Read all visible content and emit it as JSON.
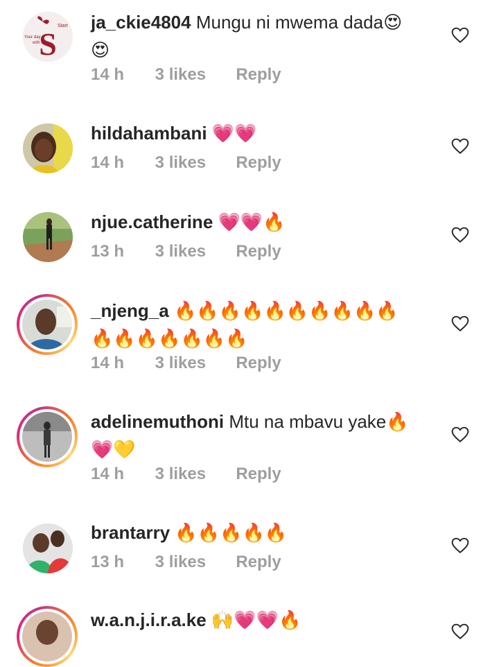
{
  "comments": [
    {
      "username": "ja_ckie4804",
      "text": "Mungu ni mwema dada😍",
      "text2": "😍",
      "time": "14 h",
      "likes": "3 likes",
      "reply": "Reply"
    },
    {
      "username": "hildahambani",
      "text": "💗💗",
      "time": "14 h",
      "likes": "3 likes",
      "reply": "Reply"
    },
    {
      "username": "njue.catherine",
      "text": "💗💗🔥",
      "time": "13 h",
      "likes": "3 likes",
      "reply": "Reply"
    },
    {
      "username": "_njeng_a",
      "text": "🔥🔥🔥🔥🔥🔥🔥🔥🔥🔥",
      "text2": "🔥🔥🔥🔥🔥🔥🔥",
      "time": "14 h",
      "likes": "3 likes",
      "reply": "Reply"
    },
    {
      "username": "adelinemuthoni",
      "text": "Mtu na mbavu yake🔥",
      "text2": "💗💛",
      "time": "14 h",
      "likes": "3 likes",
      "reply": "Reply"
    },
    {
      "username": "brantarry",
      "text": "🔥🔥🔥🔥🔥",
      "time": "13 h",
      "likes": "3 likes",
      "reply": "Reply"
    },
    {
      "username": "w.a.n.j.i.r.a.ke",
      "text": "🙌💗💗🔥"
    }
  ],
  "avatar1_lines": [
    "Start",
    "Your day",
    "with a",
    "S"
  ],
  "icons": {
    "like": "heart-outline-icon"
  }
}
